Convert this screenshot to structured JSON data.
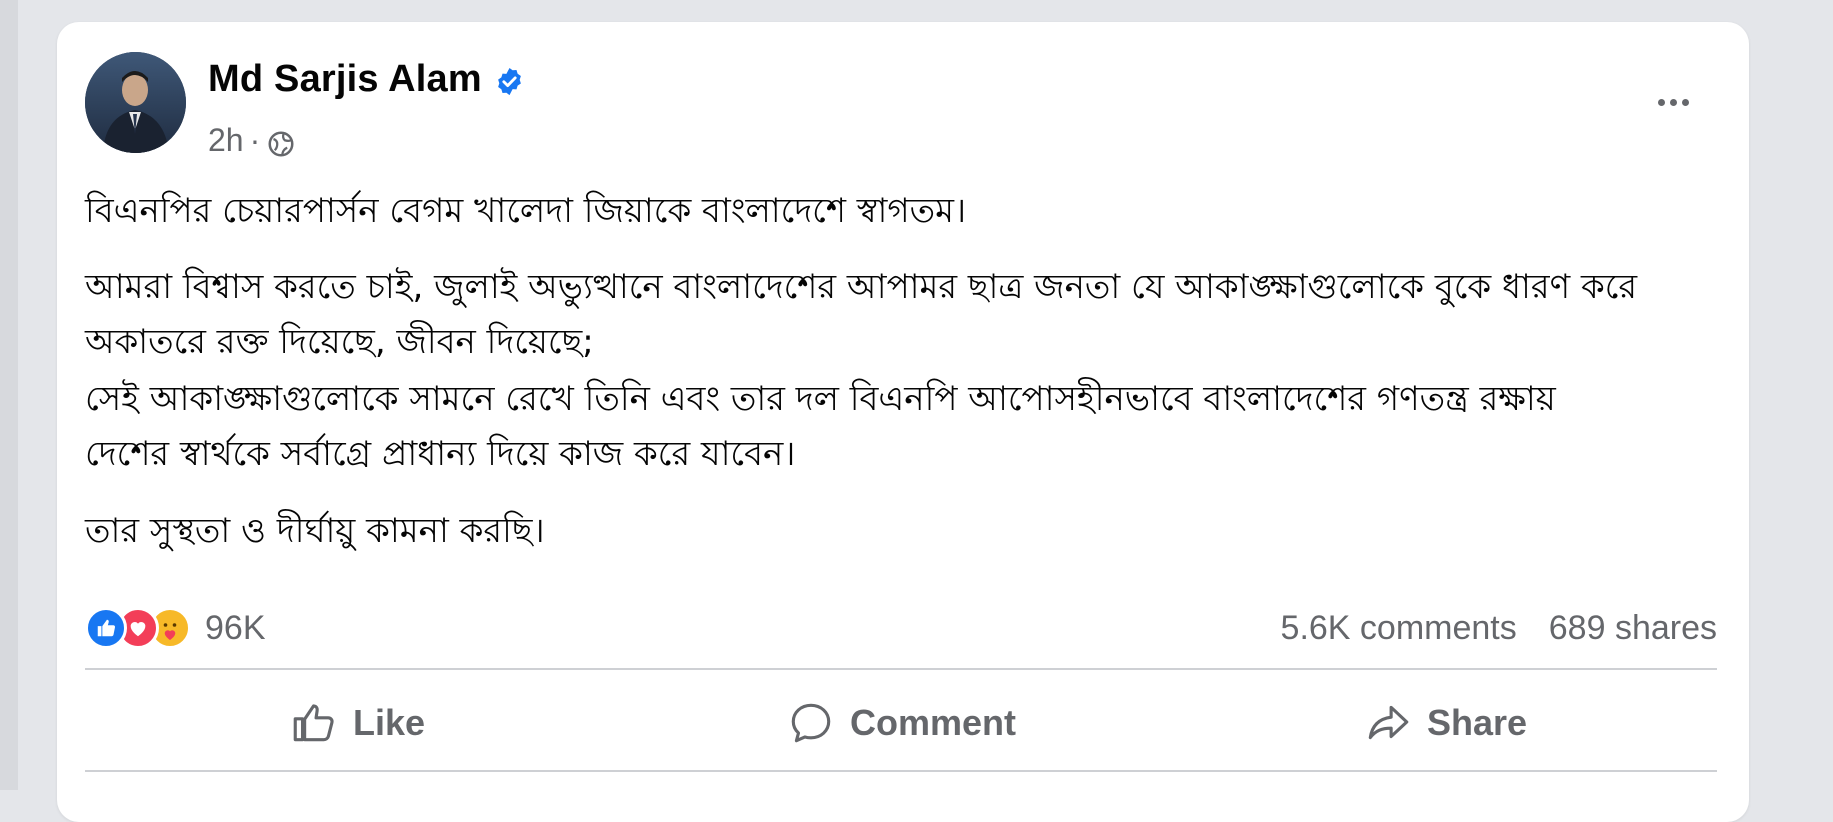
{
  "post": {
    "author": "Md Sarjis Alam",
    "time": "2h",
    "paragraphs": [
      "বিএনপির চেয়ারপার্সন বেগম খালেদা জিয়াকে বাংলাদেশে স্বাগতম।",
      "আমরা বিশ্বাস করতে চাই, জুলাই অভ্যুত্থানে বাংলাদেশের আপামর ছাত্র জনতা যে আকাঙ্ক্ষাগুলোকে বুকে ধারণ করে",
      "অকাতরে রক্ত দিয়েছে, জীবন দিয়েছে;",
      "সেই আকাঙ্ক্ষাগুলোকে সামনে রেখে তিনি এবং তার দল বিএনপি আপোসহীনভাবে বাংলাদেশের গণতন্ত্র রক্ষায়",
      "দেশের স্বার্থকে সর্বাগ্রে প্রাধান্য দিয়ে কাজ করে যাবেন।",
      "তার সুস্থতা ও দীর্ঘায়ু কামনা করছি।"
    ]
  },
  "stats": {
    "reactions_count": "96K",
    "comments": "5.6K comments",
    "shares": "689 shares"
  },
  "actions": {
    "like": "Like",
    "comment": "Comment",
    "share": "Share"
  },
  "icons": {
    "verified": "verified-badge-icon",
    "globe": "globe-icon",
    "more": "more-options-icon",
    "reactions": [
      "like-reaction-icon",
      "love-reaction-icon",
      "care-reaction-icon"
    ]
  },
  "colors": {
    "verified_blue": "#1877f2",
    "like_blue": "#1877f2",
    "love_red": "#f33e58",
    "care_yellow": "#f7b928",
    "secondary_text": "#65676b"
  }
}
